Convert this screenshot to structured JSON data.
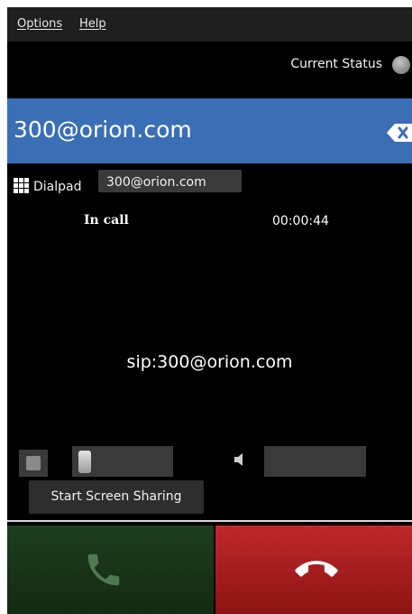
{
  "menu": {
    "options": "Options",
    "help": "Help"
  },
  "status": {
    "label": "Current Status",
    "indicator_color": "#9a9a9a"
  },
  "address": {
    "value": "300@orion.com",
    "clear_icon": "backspace-icon"
  },
  "dialpad": {
    "label": "Dialpad",
    "icon": "grid-icon"
  },
  "call_tab": {
    "label": "300@orion.com"
  },
  "call": {
    "state": "In call",
    "duration": "00:00:44",
    "uri": "sip:300@orion.com"
  },
  "controls": {
    "video_icon": "video-icon",
    "speaker_icon": "speaker-icon",
    "share_label": "Start Screen Sharing"
  },
  "buttons": {
    "call_icon": "phone-icon",
    "hangup_icon": "hangup-icon",
    "call_color": "#1e3d1e",
    "hangup_color": "#c0282c"
  }
}
